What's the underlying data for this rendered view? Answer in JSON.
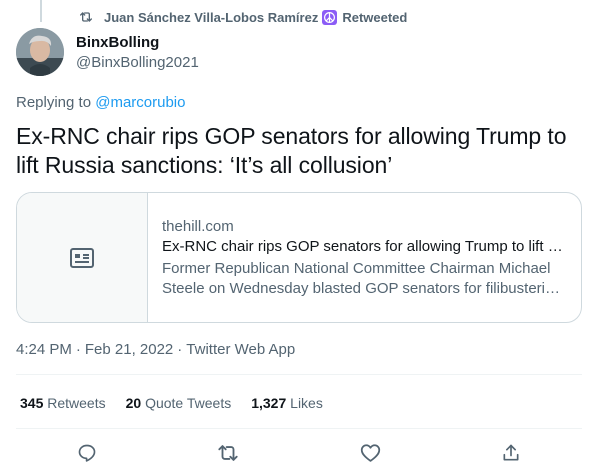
{
  "retweet": {
    "user": "Juan Sánchez Villa-Lobos Ramírez",
    "label": "Retweeted"
  },
  "author": {
    "name": "BinxBolling",
    "handle": "@BinxBolling2021"
  },
  "reply": {
    "prefix": "Replying to",
    "mention": "@marcorubio"
  },
  "tweet": {
    "text": "Ex-RNC chair rips GOP senators for allowing Trump to lift Russia sanctions: ‘It’s all collusion’"
  },
  "card": {
    "domain": "thehill.com",
    "title": "Ex-RNC chair rips GOP senators for allowing Trump to lift Russia sanctions: ‘It’s all collusion’",
    "description_line1": "Former Republican National Committee Chairman Michael",
    "description_line2": "Steele on Wednesday blasted GOP senators for filibustering legislation"
  },
  "meta": {
    "time": "4:24 PM",
    "date": "Feb 21, 2022",
    "source": "Twitter Web App",
    "separator": "·"
  },
  "stats": {
    "retweets_count": "345",
    "retweets_label": "Retweets",
    "quotes_count": "20",
    "quotes_label": "Quote Tweets",
    "likes_count": "1,327",
    "likes_label": "Likes"
  },
  "colors": {
    "accent": "#1d9bf0",
    "secondary_text": "#536471",
    "primary_text": "#0f1419",
    "border": "#cfd9de"
  },
  "icons": {
    "retweet_header": "retweet-icon",
    "badge": "peace-sign-icon",
    "card_placeholder": "article-icon",
    "reply": "reply-icon",
    "retweet": "retweet-icon",
    "like": "heart-icon",
    "share": "share-icon"
  }
}
